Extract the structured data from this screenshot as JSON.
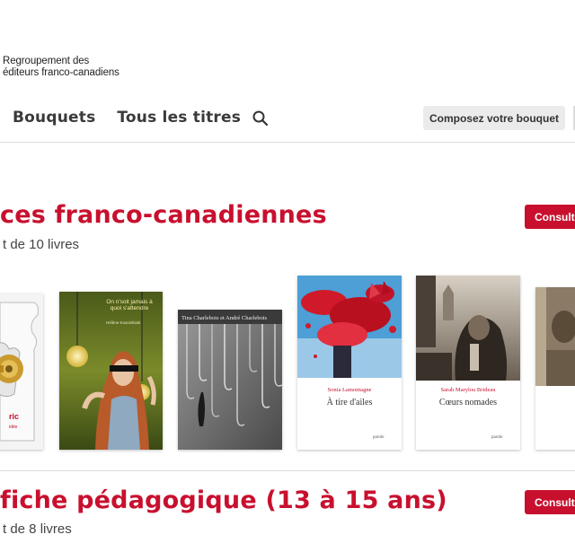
{
  "header": {
    "logo_line1": "Regroupement des",
    "logo_line2": "éditeurs franco-canadiens"
  },
  "nav": {
    "bouquets": "Bouquets",
    "tous_titres": "Tous les titres",
    "search_icon": "search-icon"
  },
  "compose_label": "Composez votre bouquet",
  "sections": [
    {
      "title": "ces franco-canadiennes",
      "subtitle": "t de 10 livres",
      "button": "Consulte"
    },
    {
      "title": "fiche pédagogique (13 à 15 ans)",
      "subtitle": "t de 8 livres",
      "button": "Consulte"
    }
  ],
  "books": [
    {
      "cover_text": "ric",
      "cover_subtext": "idée"
    },
    {
      "cover_text": "On n'soit jamais à quoi s'attendre",
      "cover_subtext": "Hélène Koscielniak"
    },
    {
      "cover_text": "Tina Charlebois et André Charlebois"
    },
    {
      "author": "Sonia Lamontagne",
      "title": "À tire d'ailes",
      "publisher": "parole"
    },
    {
      "author": "Sarah Marylou Brideau",
      "title": "Cœurs nomades",
      "publisher": "parole"
    },
    {}
  ],
  "colors": {
    "accent": "#c8102e",
    "button_grey": "#ebebeb"
  }
}
